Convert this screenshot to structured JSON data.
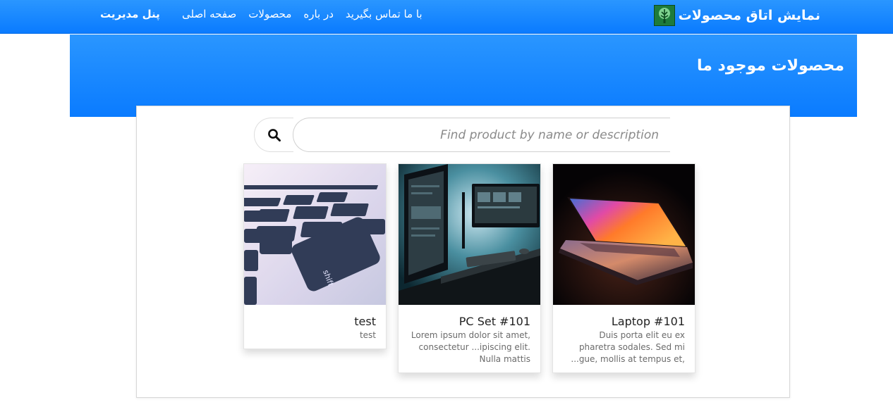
{
  "navbar": {
    "brand_title": "نمایش اتاق محصولات",
    "brand_logo_icon": "tree-logo-icon",
    "links": [
      {
        "label": "صفحه اصلی"
      },
      {
        "label": "محصولات"
      },
      {
        "label": "در باره"
      },
      {
        "label": "با ما تماس بگیرید"
      }
    ],
    "admin_label": "پنل مدیریت",
    "background_color": "#1a86ff"
  },
  "hero": {
    "title": "محصولات موجود ما"
  },
  "search": {
    "placeholder": "Find product by name or description",
    "value": "",
    "button_icon": "search-icon"
  },
  "products": [
    {
      "title": "Laptop #101",
      "description": "Duis porta elit eu ex pharetra sodales. Sed mi ...gue, mollis at tempus et,",
      "image_icon": "laptop-photo"
    },
    {
      "title": "PC Set #101",
      "description": "Lorem ipsum dolor sit amet, consectetur ...ipiscing elit. Nulla mattis",
      "image_icon": "pc-setup-photo"
    },
    {
      "title": "test",
      "description": "test",
      "image_icon": "keyboard-photo"
    }
  ]
}
